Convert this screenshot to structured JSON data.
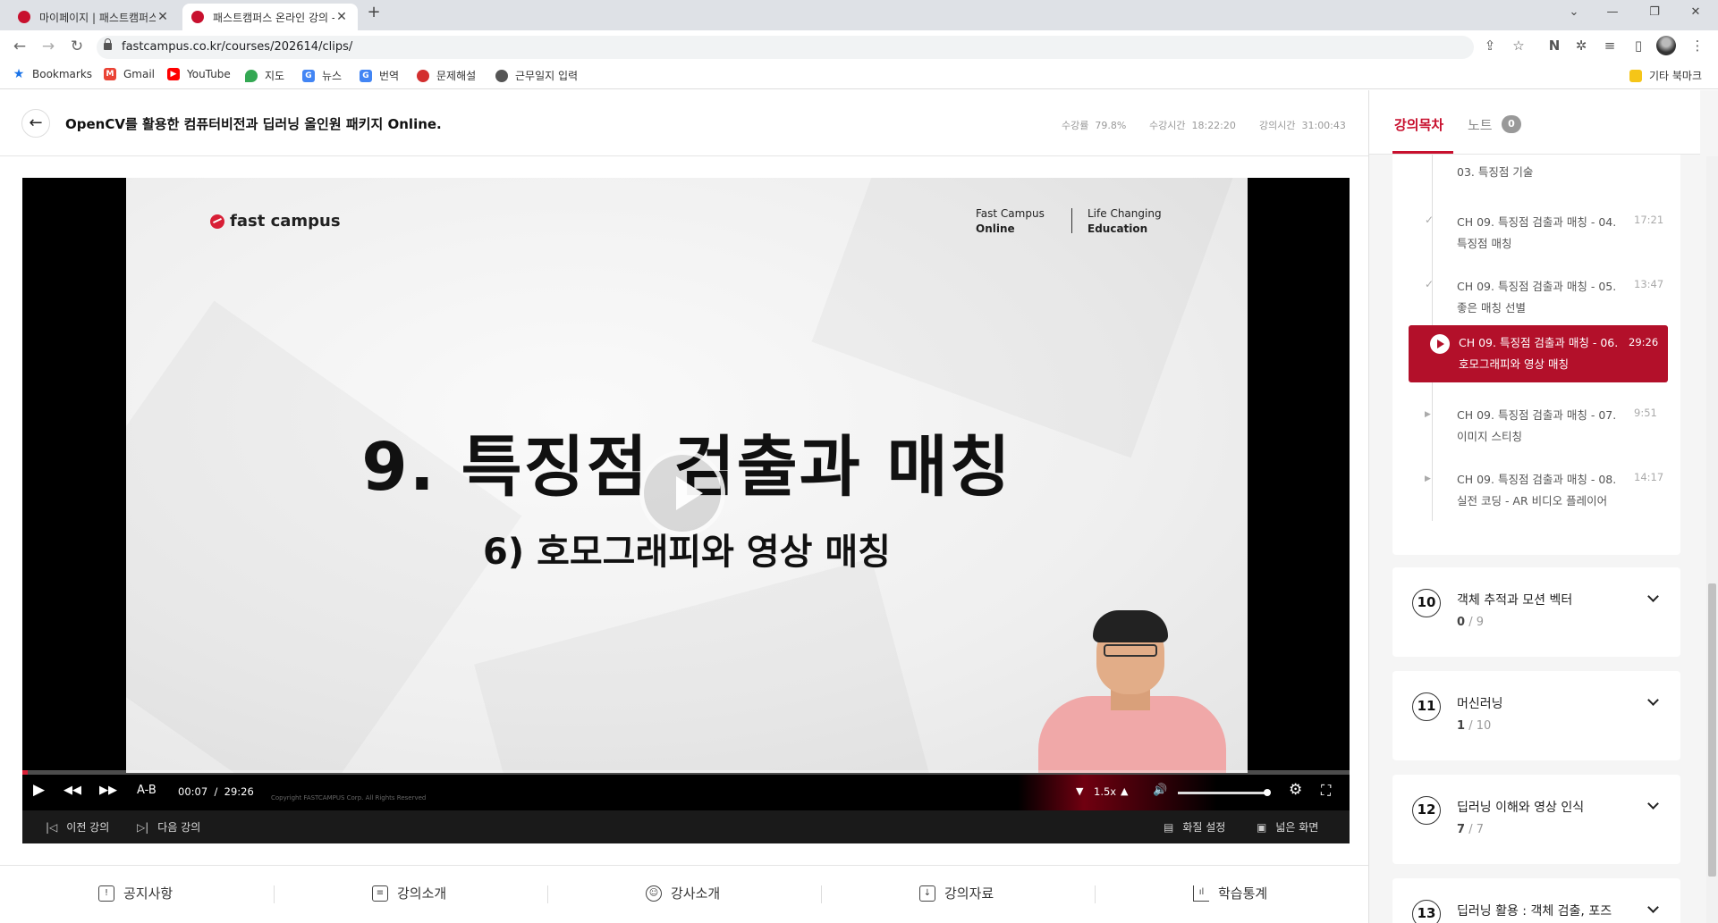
{
  "browser": {
    "tabs": [
      {
        "title": "마이페이지 | 패스트캠퍼스",
        "active": false
      },
      {
        "title": "패스트캠퍼스 온라인 강의 - 올인",
        "active": true
      }
    ],
    "url": "fastcampus.co.kr/courses/202614/clips/",
    "bookmarks": [
      {
        "label": "Bookmarks",
        "icon": "star-icon",
        "color": "#1a73e8"
      },
      {
        "label": "Gmail",
        "icon": "gmail-icon",
        "color": "#ea4335"
      },
      {
        "label": "YouTube",
        "icon": "youtube-icon",
        "color": "#ff0000"
      },
      {
        "label": "지도",
        "icon": "maps-icon",
        "color": "#34a853"
      },
      {
        "label": "뉴스",
        "icon": "news-icon",
        "color": "#4285f4"
      },
      {
        "label": "번역",
        "icon": "translate-icon",
        "color": "#4285f4"
      },
      {
        "label": "문제해설",
        "icon": "bookmark-icon",
        "color": "#d32f2f"
      },
      {
        "label": "근무일지 입력",
        "icon": "globe-icon",
        "color": "#555555"
      }
    ],
    "other_bookmarks": "기타 북마크"
  },
  "header": {
    "course_title": "OpenCV를 활용한 컴퓨터비전과 딥러닝 올인원 패키지 Online.",
    "stats": [
      {
        "label": "수강률",
        "value": "79.8%"
      },
      {
        "label": "수강시간",
        "value": "18:22:20"
      },
      {
        "label": "강의시간",
        "value": "31:00:43"
      }
    ]
  },
  "video": {
    "brand": "fast campus",
    "tagline_left": [
      "Fast Campus",
      "Online"
    ],
    "tagline_right": [
      "Life Changing",
      "Education"
    ],
    "slide_title": "9. 특징점 검출과 매칭",
    "slide_subtitle": "6) 호모그래피와 영상 매칭",
    "copyright": "Copyright FASTCAMPUS Corp. All Rights Reserved",
    "current_time": "00:07",
    "total_time": "29:26",
    "progress": 0.004,
    "ab_label": "A-B",
    "speed": "1.5x",
    "volume": 1.0,
    "prev_lecture": "이전 강의",
    "next_lecture": "다음 강의",
    "quality": "화질 설정",
    "wide": "넓은 화면"
  },
  "bottom_tabs": [
    {
      "label": "공지사항",
      "icon": "notice-icon"
    },
    {
      "label": "강의소개",
      "icon": "clipboard-icon"
    },
    {
      "label": "강사소개",
      "icon": "user-icon"
    },
    {
      "label": "강의자료",
      "icon": "download-icon"
    },
    {
      "label": "학습통계",
      "icon": "stats-icon"
    }
  ],
  "sidebar": {
    "tab_toc": "강의목차",
    "tab_note": "노트",
    "note_count": "0",
    "clips": [
      {
        "title": "03. 특징점 기술",
        "duration": "",
        "status": "done"
      },
      {
        "title": "CH 09. 특징점 검출과 매칭 - 04. 특징점 매칭",
        "duration": "17:21",
        "status": "done"
      },
      {
        "title": "CH 09. 특징점 검출과 매칭 - 05. 좋은 매칭 선별",
        "duration": "13:47",
        "status": "done"
      },
      {
        "title": "CH 09. 특징점 검출과 매칭 - 06. 호모그래피와 영상 매칭",
        "duration": "29:26",
        "status": "current"
      },
      {
        "title": "CH 09. 특징점 검출과 매칭 - 07. 이미지 스티칭",
        "duration": "9:51",
        "status": "todo"
      },
      {
        "title": "CH 09. 특징점 검출과 매칭 - 08. 실전 코딩 - AR 비디오 플레이어",
        "duration": "14:17",
        "status": "todo"
      }
    ],
    "sections": [
      {
        "num": "10",
        "title": "객체 추적과 모션 벡터",
        "done": "0",
        "total": "9"
      },
      {
        "num": "11",
        "title": "머신러닝",
        "done": "1",
        "total": "10"
      },
      {
        "num": "12",
        "title": "딥러닝 이해와 영상 인식",
        "done": "7",
        "total": "7"
      },
      {
        "num": "13",
        "title": "딥러닝 활용 : 객체 검출, 포즈",
        "done": "",
        "total": ""
      }
    ]
  },
  "colors": {
    "accent": "#c8102e",
    "brand_red": "#d81f36"
  }
}
